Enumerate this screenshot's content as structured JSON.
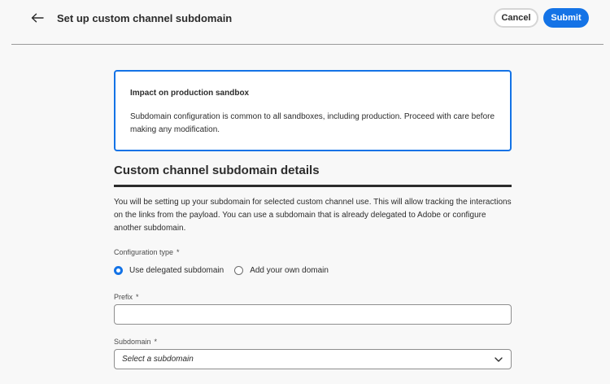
{
  "header": {
    "title": "Set up custom channel subdomain",
    "cancel_label": "Cancel",
    "submit_label": "Submit",
    "back_icon": "arrow-left-icon"
  },
  "notice": {
    "title": "Impact on production sandbox",
    "body": "Subdomain configuration is common to all sandboxes, including production. Proceed with care before making any modification."
  },
  "section": {
    "heading": "Custom channel subdomain details",
    "description": "You will be setting up your subdomain for selected custom channel use. This will allow tracking the interactions on the links from the payload. You can use a subdomain that is already delegated to Adobe or configure another subdomain."
  },
  "form": {
    "required_marker": "*",
    "configuration_type": {
      "label": "Configuration type",
      "options": [
        {
          "label": "Use delegated subdomain",
          "checked": true
        },
        {
          "label": "Add your own domain",
          "checked": false
        }
      ]
    },
    "prefix": {
      "label": "Prefix",
      "value": ""
    },
    "subdomain": {
      "label": "Subdomain",
      "placeholder": "Select a subdomain",
      "icon": "chevron-down-icon"
    }
  },
  "colors": {
    "accent": "#1473e6",
    "text": "#2c2c2c",
    "background": "#f8f8f8"
  }
}
